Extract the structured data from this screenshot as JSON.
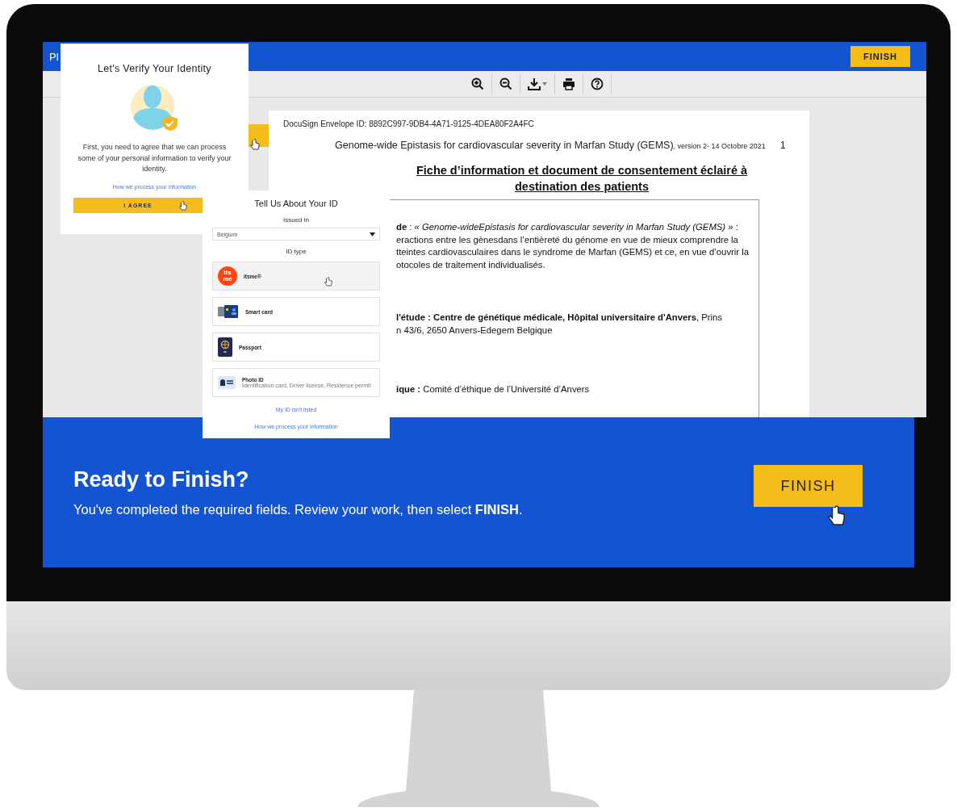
{
  "top_bar": {
    "title_fragment": "Pl",
    "finish_button": "FINISH"
  },
  "document": {
    "envelope_id": "DocuSign Envelope ID: 8892C997-9DB4-4A71-9125-4DEA80F2A4FC",
    "header_title": "Genome-wide Epistasis for cardiovascular severity in Marfan Study (GEMS)",
    "header_version": ", version 2- 14 Octobre 2021",
    "page_number": "1",
    "heading": "Fiche d’information et document de consentement éclairé à destination des patients",
    "paragraphs": [
      [
        "**de** : *« Genome-wideEpistasis for cardiovascular severity in Marfan Study (GEMS) »* :",
        "eractions entre les gènesdans l’entièreté du génome en vue de mieux comprendre  la",
        "tteintes cardiovasculaires dans le syndrome de Marfan (GEMS) et ce, en vue d’ouvrir la",
        "otocoles de traitement individualisés."
      ],
      [
        "**l'étude :  Centre de génétique médicale, Hôpital universitaire d'Anvers**, Prins",
        "n 43/6, 2650 Anvers-Edegem Belgique"
      ],
      [
        "**ique :** Comité d’éthique de l’Université d’Anvers"
      ]
    ]
  },
  "verify_dialog": {
    "title": "Let's Verify Your Identity",
    "body": "First, you need to agree that we can process some of your personal information to verify your identity.",
    "link": "How we process your information",
    "button": "I AGREE"
  },
  "id_dialog": {
    "title": "Tell Us About Your ID",
    "issued_label": "Issued in",
    "country": "Belgium",
    "id_type_label": "ID type",
    "options": [
      {
        "kind": "itsme",
        "label": "itsme®",
        "logo_lines": [
          "its",
          "me"
        ],
        "highlighted": true
      },
      {
        "kind": "smartcard",
        "label": "Smart card",
        "highlighted": false
      },
      {
        "kind": "passport",
        "label": "Passport",
        "highlighted": false
      },
      {
        "kind": "photoid",
        "label": "Photo ID",
        "subtitle": "Identification card, Driver license, Residence permit",
        "highlighted": false
      }
    ],
    "not_listed_link": "My ID isn't listed",
    "process_link": "How we process your information"
  },
  "banner": {
    "title": "Ready to Finish?",
    "text": "You've completed the required fields. Review your work, then select **FINISH**.",
    "button": "FINISH"
  }
}
